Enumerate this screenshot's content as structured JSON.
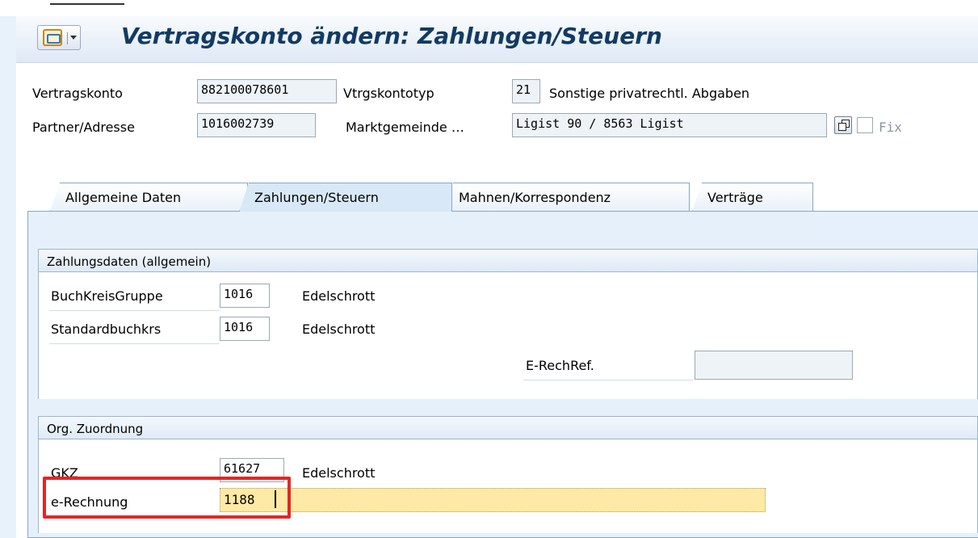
{
  "window": {
    "title": "Vertragskonto ändern: Zahlungen/Steuern"
  },
  "header": {
    "vertragskonto_label": "Vertragskonto",
    "vertragskonto_value": "882100078601",
    "vtrgskontotyp_label": "Vtrgskontotyp",
    "vtrgskontotyp_value": "21",
    "vtrgskontotyp_text": "Sonstige privatrechtl. Abgaben",
    "partner_label": "Partner/Adresse",
    "partner_value": "1016002739",
    "partner_name": "Marktgemeinde …",
    "address_value": "Ligist 90 / 8563 Ligist",
    "fix_label": "Fix"
  },
  "tabs": [
    {
      "label": "Allgemeine Daten"
    },
    {
      "label": "Zahlungen/Steuern"
    },
    {
      "label": "Mahnen/Korrespondenz"
    },
    {
      "label": "Verträge"
    }
  ],
  "zahlungsdaten": {
    "title": "Zahlungsdaten (allgemein)",
    "buchkreisgruppe_label": "BuchKreisGruppe",
    "buchkreisgruppe_value": "1016",
    "buchkreisgruppe_text": "Edelschrott",
    "standardbuchkrs_label": "Standardbuchkrs",
    "standardbuchkrs_value": "1016",
    "standardbuchkrs_text": "Edelschrott",
    "erechref_label": "E-RechRef.",
    "erechref_value": ""
  },
  "org": {
    "title": "Org. Zuordnung",
    "gkz_label": "GKZ",
    "gkz_value": "61627",
    "gkz_text": "Edelschrott",
    "erechnung_label": "e-Rechnung",
    "erechnung_value": "1188"
  },
  "icons": {
    "title_icon": "user-settings-icon",
    "copy_icon": "copy-icon",
    "checkbox_icon": "checkbox-icon"
  },
  "colors": {
    "title": "#123b63",
    "highlight": "#e32626",
    "field_background": "#ffe9a6"
  }
}
